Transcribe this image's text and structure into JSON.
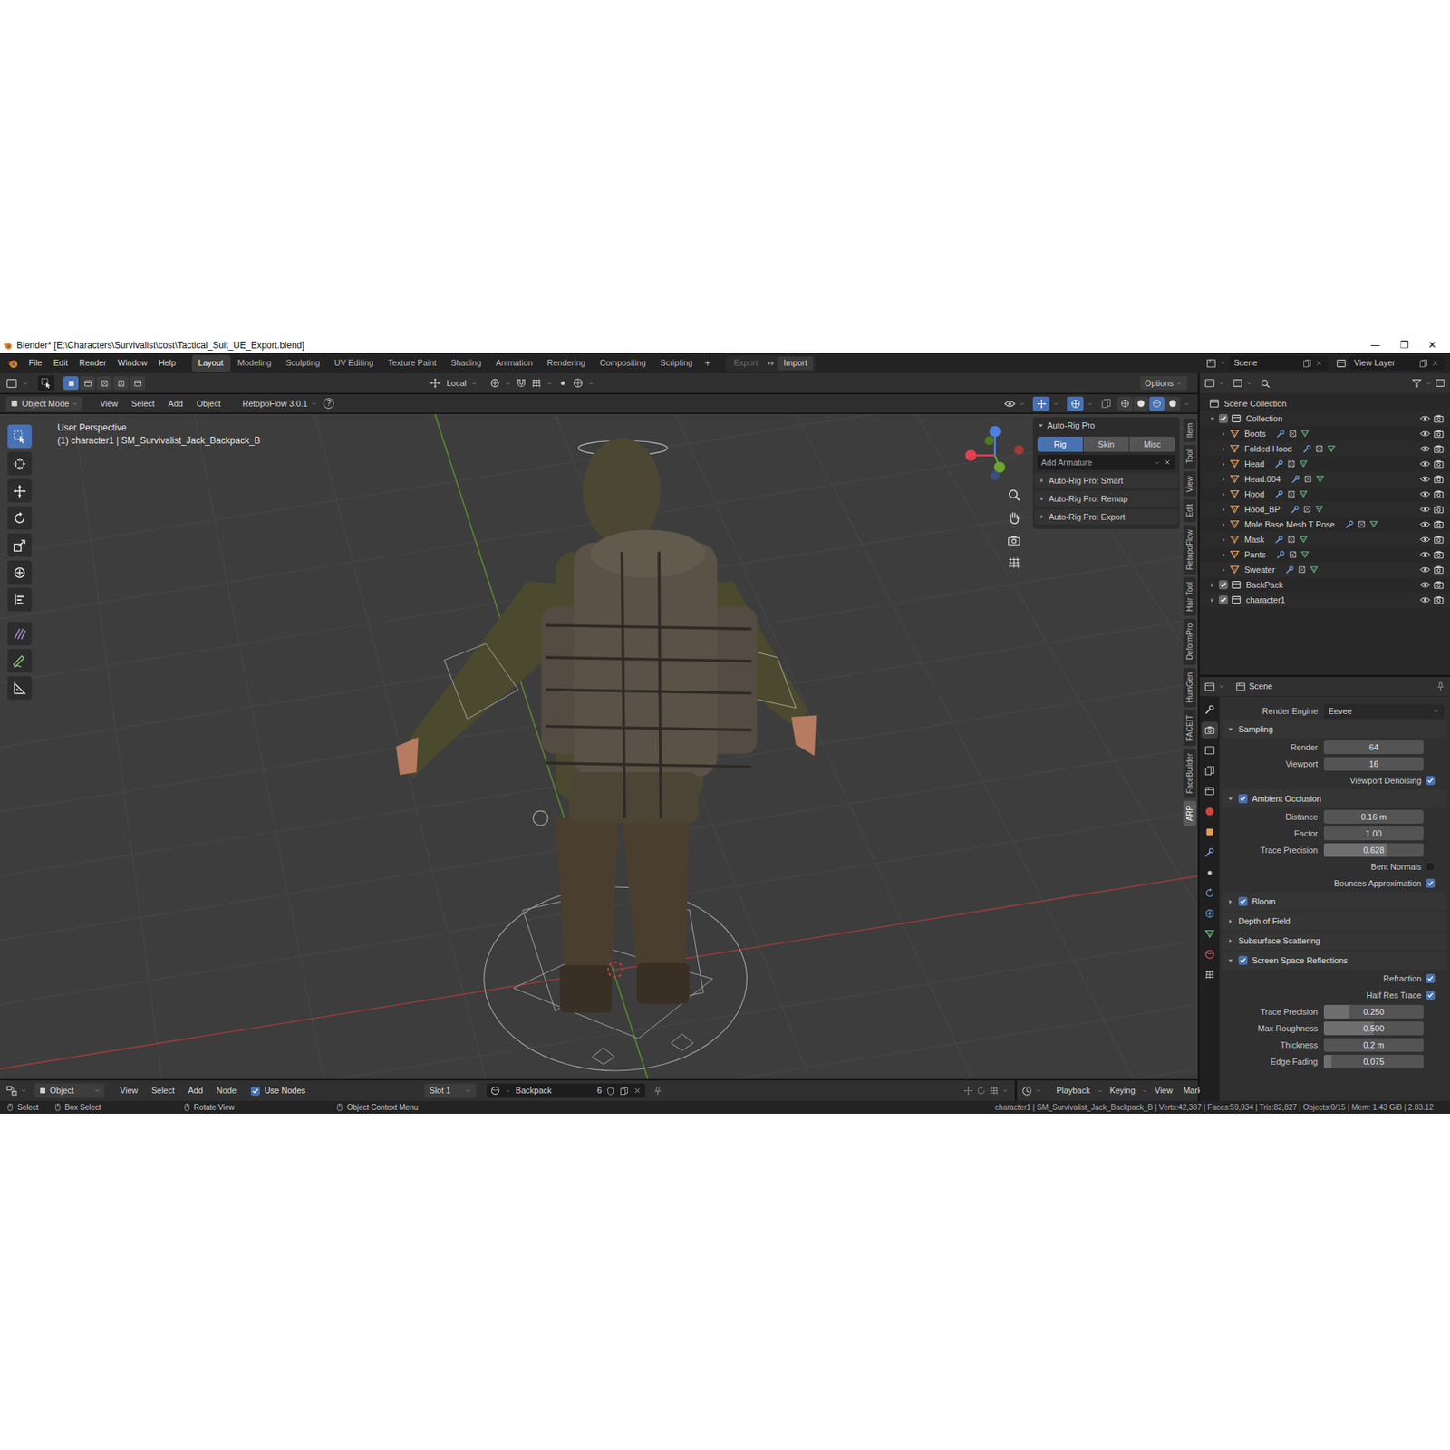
{
  "window": {
    "title": "Blender* [E:\\Characters\\Survivalist\\cost\\Tactical_Suit_UE_Export.blend]",
    "controls": [
      "—",
      "❐",
      "✕"
    ]
  },
  "menubar": {
    "menus": [
      "File",
      "Edit",
      "Render",
      "Window",
      "Help"
    ],
    "workspaces": [
      {
        "label": "Layout",
        "selected": true
      },
      {
        "label": "Modeling",
        "selected": false
      },
      {
        "label": "Sculpting",
        "selected": false
      },
      {
        "label": "UV Editing",
        "selected": false
      },
      {
        "label": "Texture Paint",
        "selected": false
      },
      {
        "label": "Shading",
        "selected": false
      },
      {
        "label": "Animation",
        "selected": false
      },
      {
        "label": "Rendering",
        "selected": false
      },
      {
        "label": "Compositing",
        "selected": false
      },
      {
        "label": "Scripting",
        "selected": false
      }
    ],
    "add_tab": "+",
    "extra": [
      {
        "label": "Export",
        "disabled": true
      },
      {
        "label": "Import",
        "disabled": false
      }
    ],
    "scene": "Scene",
    "view_layer": "View Layer"
  },
  "tool_header": {
    "orientation": "Local",
    "options": "Options"
  },
  "viewport_header": {
    "mode": "Object Mode",
    "menus": [
      "View",
      "Select",
      "Add",
      "Object"
    ],
    "addon": "RetopoFlow 3.0.1",
    "help": "?",
    "shading": [
      {
        "selected": false
      },
      {
        "selected": false
      },
      {
        "selected": true
      },
      {
        "selected": false
      }
    ]
  },
  "viewport": {
    "perspective": "User Perspective",
    "object": "(1) character1 | SM_Survivalist_Jack_Backpack_B",
    "tools": [
      {
        "selected": true
      },
      {
        "selected": false
      },
      {
        "selected": false
      },
      {
        "selected": false
      },
      {
        "selected": false
      },
      {
        "selected": false
      },
      {
        "selected": false
      },
      {
        "selected": false
      },
      {
        "selected": false
      },
      {
        "selected": false
      }
    ]
  },
  "sidebar": {
    "title": "Auto-Rig Pro",
    "tabs": [
      {
        "label": "Rig",
        "selected": true
      },
      {
        "label": "Skin",
        "selected": false
      },
      {
        "label": "Misc",
        "selected": false
      }
    ],
    "field": "Add Armature",
    "sections": [
      "Auto-Rig Pro: Smart",
      "Auto-Rig Pro: Remap",
      "Auto-Rig Pro: Export"
    ],
    "region_tabs": [
      {
        "label": "Item",
        "selected": false
      },
      {
        "label": "Tool",
        "selected": false
      },
      {
        "label": "View",
        "selected": false
      },
      {
        "label": "Edit",
        "selected": false
      },
      {
        "label": "RetopoFlow",
        "selected": false
      },
      {
        "label": "Hair Tool",
        "selected": false
      },
      {
        "label": "DeformPro",
        "selected": false
      },
      {
        "label": "HumGen",
        "selected": false
      },
      {
        "label": "FACEIT",
        "selected": false
      },
      {
        "label": "FaceBuilder",
        "selected": false
      },
      {
        "label": "ARP",
        "selected": true
      }
    ]
  },
  "outliner": {
    "rows": [
      {
        "label": "Scene Collection",
        "depth": 0,
        "kind": "scene"
      },
      {
        "label": "Collection",
        "depth": 1,
        "kind": "collection",
        "expanded": true,
        "checked": true
      },
      {
        "label": "Boots",
        "depth": 2,
        "kind": "mesh",
        "expanded": false
      },
      {
        "label": "Folded Hood",
        "depth": 2,
        "kind": "mesh",
        "expanded": false
      },
      {
        "label": "Head",
        "depth": 2,
        "kind": "mesh",
        "expanded": false
      },
      {
        "label": "Head.004",
        "depth": 2,
        "kind": "mesh",
        "expanded": false
      },
      {
        "label": "Hood",
        "depth": 2,
        "kind": "mesh",
        "expanded": false
      },
      {
        "label": "Hood_BP",
        "depth": 2,
        "kind": "mesh",
        "expanded": false
      },
      {
        "label": "Male Base Mesh T Pose",
        "depth": 2,
        "kind": "mesh",
        "expanded": false
      },
      {
        "label": "Mask",
        "depth": 2,
        "kind": "mesh",
        "expanded": false
      },
      {
        "label": "Pants",
        "depth": 2,
        "kind": "mesh",
        "expanded": false
      },
      {
        "label": "Sweater",
        "depth": 2,
        "kind": "mesh",
        "expanded": false
      },
      {
        "label": "BackPack",
        "depth": 1,
        "kind": "collection",
        "expanded": false,
        "checked": true
      },
      {
        "label": "character1",
        "depth": 1,
        "kind": "collection",
        "expanded": false,
        "checked": true
      }
    ]
  },
  "properties": {
    "header": "Scene",
    "tabs": [
      {
        "selected": false
      },
      {
        "selected": true
      },
      {
        "selected": false
      },
      {
        "selected": false
      },
      {
        "selected": false
      },
      {
        "selected": false
      },
      {
        "selected": false
      },
      {
        "selected": false
      },
      {
        "selected": false
      },
      {
        "selected": false
      },
      {
        "selected": false
      },
      {
        "selected": false
      },
      {
        "selected": false
      },
      {
        "selected": false
      }
    ],
    "rows": [
      {
        "kind": "dropdown",
        "label": "Render Engine",
        "value": "Eevee"
      },
      {
        "kind": "section",
        "label": "Sampling",
        "expanded": true
      },
      {
        "kind": "number",
        "label": "Render",
        "value": "64"
      },
      {
        "kind": "number",
        "label": "Viewport",
        "value": "16"
      },
      {
        "kind": "checkbox",
        "label": "Viewport Denoising",
        "checked": true
      },
      {
        "kind": "section",
        "label": "Ambient Occlusion",
        "expanded": true,
        "checked": true
      },
      {
        "kind": "number",
        "label": "Distance",
        "value": "0.16 m"
      },
      {
        "kind": "number",
        "label": "Factor",
        "value": "1.00"
      },
      {
        "kind": "slider",
        "label": "Trace Precision",
        "value": "0.628",
        "level": 0.628
      },
      {
        "kind": "checkbox",
        "label": "Bent Normals",
        "checked": false
      },
      {
        "kind": "checkbox",
        "label": "Bounces Approximation",
        "checked": true
      },
      {
        "kind": "section",
        "label": "Bloom",
        "expanded": false,
        "checked": true
      },
      {
        "kind": "section",
        "label": "Depth of Field",
        "expanded": false
      },
      {
        "kind": "section",
        "label": "Subsurface Scattering",
        "expanded": false
      },
      {
        "kind": "section",
        "label": "Screen Space Reflections",
        "expanded": true,
        "checked": true
      },
      {
        "kind": "checkbox",
        "label": "Refraction",
        "checked": true
      },
      {
        "kind": "checkbox",
        "label": "Half Res Trace",
        "checked": true
      },
      {
        "kind": "slider",
        "label": "Trace Precision",
        "value": "0.250",
        "level": 0.25
      },
      {
        "kind": "slider",
        "label": "Max Roughness",
        "value": "0.500",
        "level": 0.5
      },
      {
        "kind": "number",
        "label": "Thickness",
        "value": "0.2 m"
      },
      {
        "kind": "slider",
        "label": "Edge Fading",
        "value": "0.075",
        "level": 0.075
      }
    ]
  },
  "node_header": {
    "editor": "Object",
    "menus": [
      "View",
      "Select",
      "Add",
      "Node"
    ],
    "use_nodes": {
      "label": "Use Nodes",
      "checked": true
    },
    "slot": "Slot 1",
    "material": "Backpack",
    "users": "6"
  },
  "timeline_header": {
    "menus": [
      "Playback",
      "Keying",
      "View",
      "Marker"
    ]
  },
  "status_bar": {
    "hints": [
      "Select",
      "Box Select",
      "Rotate View",
      "Object Context Menu"
    ],
    "stats": "character1 | SM_Survivalist_Jack_Backpack_B | Verts:42,387 | Faces:59,934 | Tris:82,827 | Objects:0/15 | Mem: 1.43 GiB | 2.83.12"
  }
}
